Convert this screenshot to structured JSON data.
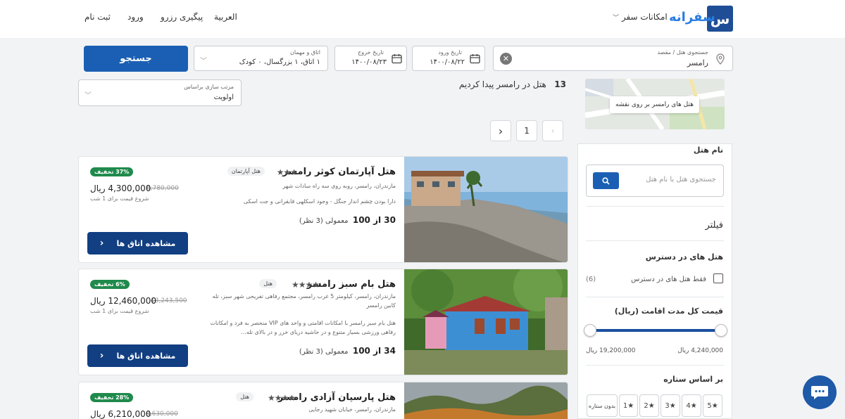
{
  "header": {
    "logo_glyph": "س",
    "logo_text": "سفرانه",
    "menu_travel": "امکانات سفر",
    "lang": "العربية",
    "track": "پیگیری رزرو",
    "login": "ورود",
    "signup": "ثبت نام",
    "brand_color": "#1f4e96"
  },
  "search": {
    "dest_label": "جستجوی هتل / مقصد",
    "dest_value": "رامسر",
    "checkin_label": "تاریخ ورود",
    "checkin_value": "۱۴۰۰/۰۸/۲۲",
    "checkout_label": "تاریخ خروج",
    "checkout_value": "۱۴۰۰/۰۸/۲۳",
    "guests_label": "اتاق و مهمان",
    "guests_value": "۱ اتاق، ۱ بزرگسال، ۰ کودک",
    "button": "جستجو"
  },
  "results": {
    "count": "13",
    "count_text": "هتل در رامسر  پیدا کردیم",
    "sort_label": "مرتب سازی براساس",
    "sort_value": "اولویت",
    "map_button": "هتل های رامسر بر روی نقشه",
    "page_current": "1"
  },
  "filters": {
    "hotel_name_title": "نام هتل",
    "hotel_name_placeholder": "جستجوی هتل با نام هتل",
    "filter_title": "فیلتر",
    "available_title": "هتل های در دسترس",
    "available_only": "فقط هتل های در دسترس",
    "available_count": "(6)",
    "price_title": "قیمت کل مدت اقامت (ریال)",
    "price_min": "4,240,000 ریال",
    "price_max": "19,200,000 ریال",
    "price_min_frac": 0,
    "price_max_frac": 1,
    "stars_title": "بر اساس ستاره",
    "star_chips": [
      "5",
      "4",
      "3",
      "2",
      "1",
      "بدون ستاره"
    ],
    "accent": "#1a5fb4"
  },
  "hotels": [
    {
      "name": "هتل آپارتمان کوثر رامسر",
      "stars": "★★★",
      "type": "هتل آپارتمان",
      "address": "مازندران، رامسر، روبه روی سه راه سادات شهر",
      "description": "دارا بودن چشم انداز جنگل - وجود اسکلهی قایقرانی و جت اسکی",
      "rating": "30 از 100",
      "rating_text": "معمولی (3 نظر)",
      "discount": "37% تخفیف",
      "old_price": "6,780,000",
      "price": "4,300,000 ریال",
      "from": "شروع قیمت برای 1 شب",
      "button": "مشاهده اتاق ها"
    },
    {
      "name": "هتل بام سبز رامسر",
      "stars": "★★★★",
      "type": "هتل",
      "address": "مازندران، رامسر، کیلومتر 5 غرب رامسر، مجتمع رفاهی تفریحی شهر سبز، تله کابین رامسر",
      "description": "هتل بام سبز رامسر با امکانات اقامتی و واحد های VIP منحصر به فرد و امکانات رفاهی ورزشی بسیار متنوع و در حاشیه دریای خزر و در بالای تله...",
      "rating": "34 از 100",
      "rating_text": "معمولی (3 نظر)",
      "discount": "6% تخفیف",
      "old_price": "13,243,500",
      "price": "12,460,000 ریال",
      "from": "شروع قیمت برای 1 شب",
      "button": "مشاهده اتاق ها"
    },
    {
      "name": "هتل پارسیان آزادی رامسر",
      "stars": "★★★★",
      "type": "هتل",
      "address": "مازندران، رامسر، خیابان شهید رجایی",
      "discount": "28% تخفیف",
      "old_price": "8,630,000",
      "price": "6,210,000 ریال"
    }
  ]
}
